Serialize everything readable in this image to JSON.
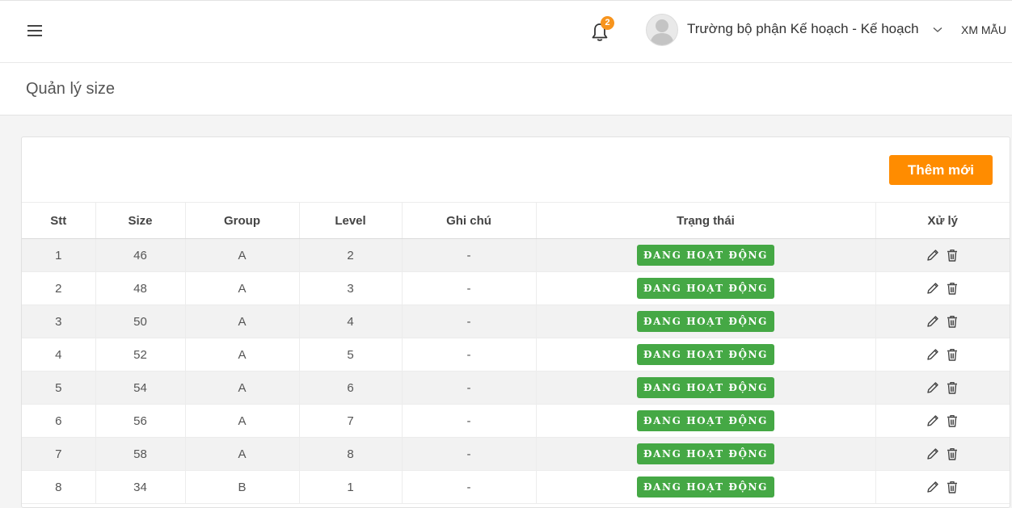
{
  "header": {
    "notification_count": "2",
    "user_name": "Trường bộ phận Kế hoạch - Kế hoạch",
    "company": "XM MẪU"
  },
  "page": {
    "title": "Quản lý size",
    "add_button_label": "Thêm mới"
  },
  "table": {
    "columns": [
      "Stt",
      "Size",
      "Group",
      "Level",
      "Ghi chú",
      "Trạng thái",
      "Xử lý"
    ],
    "rows": [
      {
        "stt": "1",
        "size": "46",
        "group": "A",
        "level": "2",
        "note": "-",
        "status": "ĐANG HOẠT ĐỘNG"
      },
      {
        "stt": "2",
        "size": "48",
        "group": "A",
        "level": "3",
        "note": "-",
        "status": "ĐANG HOẠT ĐỘNG"
      },
      {
        "stt": "3",
        "size": "50",
        "group": "A",
        "level": "4",
        "note": "-",
        "status": "ĐANG HOẠT ĐỘNG"
      },
      {
        "stt": "4",
        "size": "52",
        "group": "A",
        "level": "5",
        "note": "-",
        "status": "ĐANG HOẠT ĐỘNG"
      },
      {
        "stt": "5",
        "size": "54",
        "group": "A",
        "level": "6",
        "note": "-",
        "status": "ĐANG HOẠT ĐỘNG"
      },
      {
        "stt": "6",
        "size": "56",
        "group": "A",
        "level": "7",
        "note": "-",
        "status": "ĐANG HOẠT ĐỘNG"
      },
      {
        "stt": "7",
        "size": "58",
        "group": "A",
        "level": "8",
        "note": "-",
        "status": "ĐANG HOẠT ĐỘNG"
      },
      {
        "stt": "8",
        "size": "34",
        "group": "B",
        "level": "1",
        "note": "-",
        "status": "ĐANG HOẠT ĐỘNG"
      }
    ]
  },
  "icons": {
    "menu": "hamburger-icon",
    "notifications": "bell-icon",
    "avatar": "user-avatar-icon",
    "dropdown": "caret-down-icon",
    "edit": "pencil-icon",
    "delete": "trash-icon"
  },
  "colors": {
    "accent": "#ff8c00",
    "badge": "#f7941d",
    "status_active": "#45a845"
  }
}
